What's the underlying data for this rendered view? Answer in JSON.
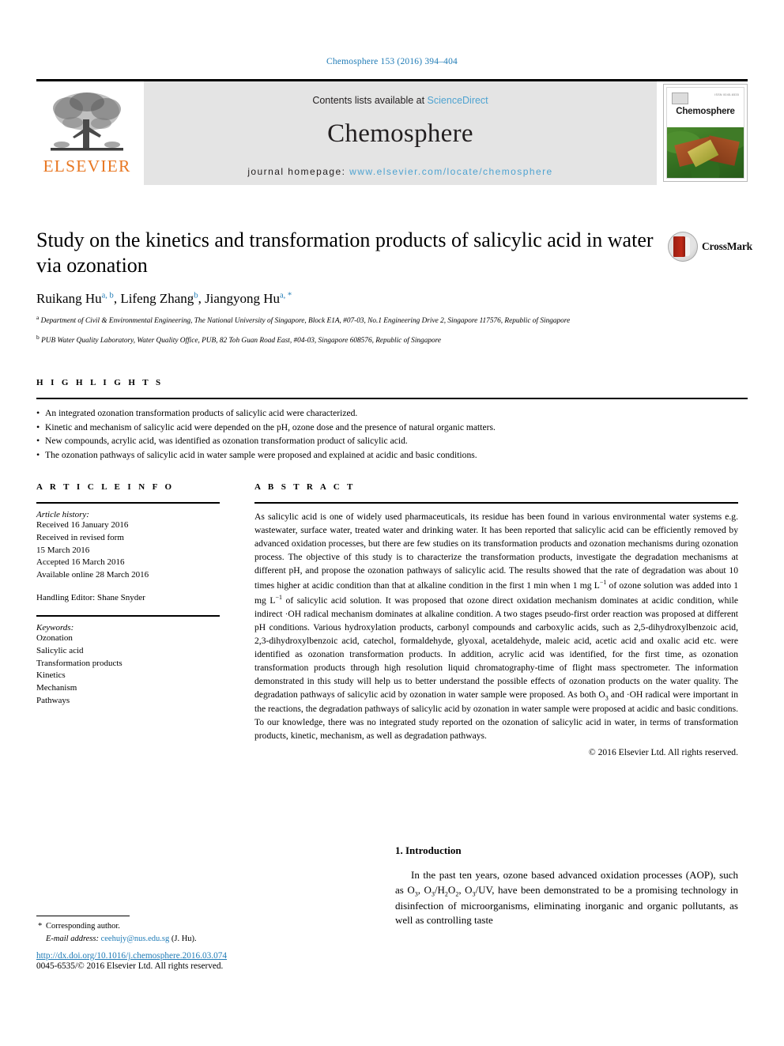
{
  "running_head": "Chemosphere 153 (2016) 394–404",
  "masthead": {
    "publisher_name": "ELSEVIER",
    "contents_prefix": "Contents lists available at ",
    "contents_link": "ScienceDirect",
    "journal_name": "Chemosphere",
    "homepage_prefix": "journal homepage: ",
    "homepage_url": "www.elsevier.com/locate/chemosphere",
    "cover_title": "Chemosphere",
    "cover_code": "ISSN 0045-6535"
  },
  "article": {
    "title": "Study on the kinetics and transformation products of salicylic acid in water via ozonation",
    "authors": [
      {
        "name": "Ruikang Hu",
        "marks": "a, b",
        "sep": ", "
      },
      {
        "name": "Lifeng Zhang",
        "marks": "b",
        "sep": ", "
      },
      {
        "name": "Jiangyong Hu",
        "marks": "a, *",
        "sep": ""
      }
    ],
    "affiliations": [
      {
        "mark": "a",
        "text": "Department of Civil & Environmental Engineering, The National University of Singapore, Block E1A, #07-03, No.1 Engineering Drive 2, Singapore 117576, Republic of Singapore"
      },
      {
        "mark": "b",
        "text": "PUB Water Quality Laboratory, Water Quality Office, PUB, 82 Toh Guan Road East, #04-03, Singapore 608576, Republic of Singapore"
      }
    ],
    "crossmark_label": "CrossMark"
  },
  "highlights": {
    "heading": "H I G H L I G H T S",
    "items": [
      "An integrated ozonation transformation products of salicylic acid were characterized.",
      "Kinetic and mechanism of salicylic acid were depended on the pH, ozone dose and the presence of natural organic matters.",
      "New compounds, acrylic acid, was identified as ozonation transformation product of salicylic acid.",
      "The ozonation pathways of salicylic acid in water sample were proposed and explained at acidic and basic conditions."
    ]
  },
  "article_info": {
    "heading": "A R T I C L E  I N F O",
    "history_label": "Article history:",
    "history_lines": [
      "Received 16 January 2016",
      "Received in revised form",
      "15 March 2016",
      "Accepted 16 March 2016",
      "Available online 28 March 2016"
    ],
    "handling_editor": "Handling Editor: Shane Snyder",
    "keywords_label": "Keywords:",
    "keywords": [
      "Ozonation",
      "Salicylic acid",
      "Transformation products",
      "Kinetics",
      "Mechanism",
      "Pathways"
    ]
  },
  "abstract": {
    "heading": "A B S T R A C T",
    "paragraphs": [
      "As salicylic acid is one of widely used pharmaceuticals, its residue has been found in various environmental water systems e.g. wastewater, surface water, treated water and drinking water. It has been reported that salicylic acid can be efficiently removed by advanced oxidation processes, but there are few studies on its transformation products and ozonation mechanisms during ozonation process. The objective of this study is to characterize the transformation products, investigate the degradation mechanisms at different pH, and propose the ozonation pathways of salicylic acid. The results showed that the rate of degradation was about 10 times higher at acidic condition than that at alkaline condition in the first 1 min when 1 mg L⁻¹ of ozone solution was added into 1 mg L⁻¹ of salicylic acid solution. It was proposed that ozone direct oxidation mechanism dominates at acidic condition, while indirect ·OH radical mechanism dominates at alkaline condition. A two stages pseudo-first order reaction was proposed at different pH conditions. Various hydroxylation products, carbonyl compounds and carboxylic acids, such as 2,5-dihydroxylbenzoic acid, 2,3-dihydroxylbenzoic acid, catechol, formaldehyde, glyoxal, acetaldehyde, maleic acid, acetic acid and oxalic acid etc. were identified as ozonation transformation products. In addition, acrylic acid was identified, for the first time, as ozonation transformation products through high resolution liquid chromatography-time of flight mass spectrometer. The information demonstrated in this study will help us to better understand the possible effects of ozonation products on the water quality. The degradation pathways of salicylic acid by ozonation in water sample were proposed. As both O3 and ·OH radical were important in the reactions, the degradation pathways of salicylic acid by ozonation in water sample were proposed at acidic and basic conditions. To our knowledge, there was no integrated study reported on the ozonation of salicylic acid in water, in terms of transformation products, kinetic, mechanism, as well as degradation pathways."
    ],
    "copyright": "© 2016 Elsevier Ltd. All rights reserved."
  },
  "introduction": {
    "heading": "1.  Introduction",
    "paragraph": "In the past ten years, ozone based advanced oxidation processes (AOP), such as O3, O3/H2O2, O3/UV, have been demonstrated to be a promising technology in disinfection of microorganisms, eliminating inorganic and organic pollutants, as well as controlling taste"
  },
  "footer": {
    "corresponding_star": "*",
    "corresponding_label": "Corresponding author.",
    "email_label": "E-mail address:",
    "email": "ceehujy@nus.edu.sg",
    "email_suffix": "(J. Hu).",
    "doi_url": "http://dx.doi.org/10.1016/j.chemosphere.2016.03.074",
    "issn_line": "0045-6535/© 2016 Elsevier Ltd. All rights reserved."
  },
  "colors": {
    "link_blue": "#1f7bb6",
    "sciencedirect_blue": "#4fa3d1",
    "elsevier_orange": "#e87722",
    "band_gray": "#e4e4e4"
  }
}
